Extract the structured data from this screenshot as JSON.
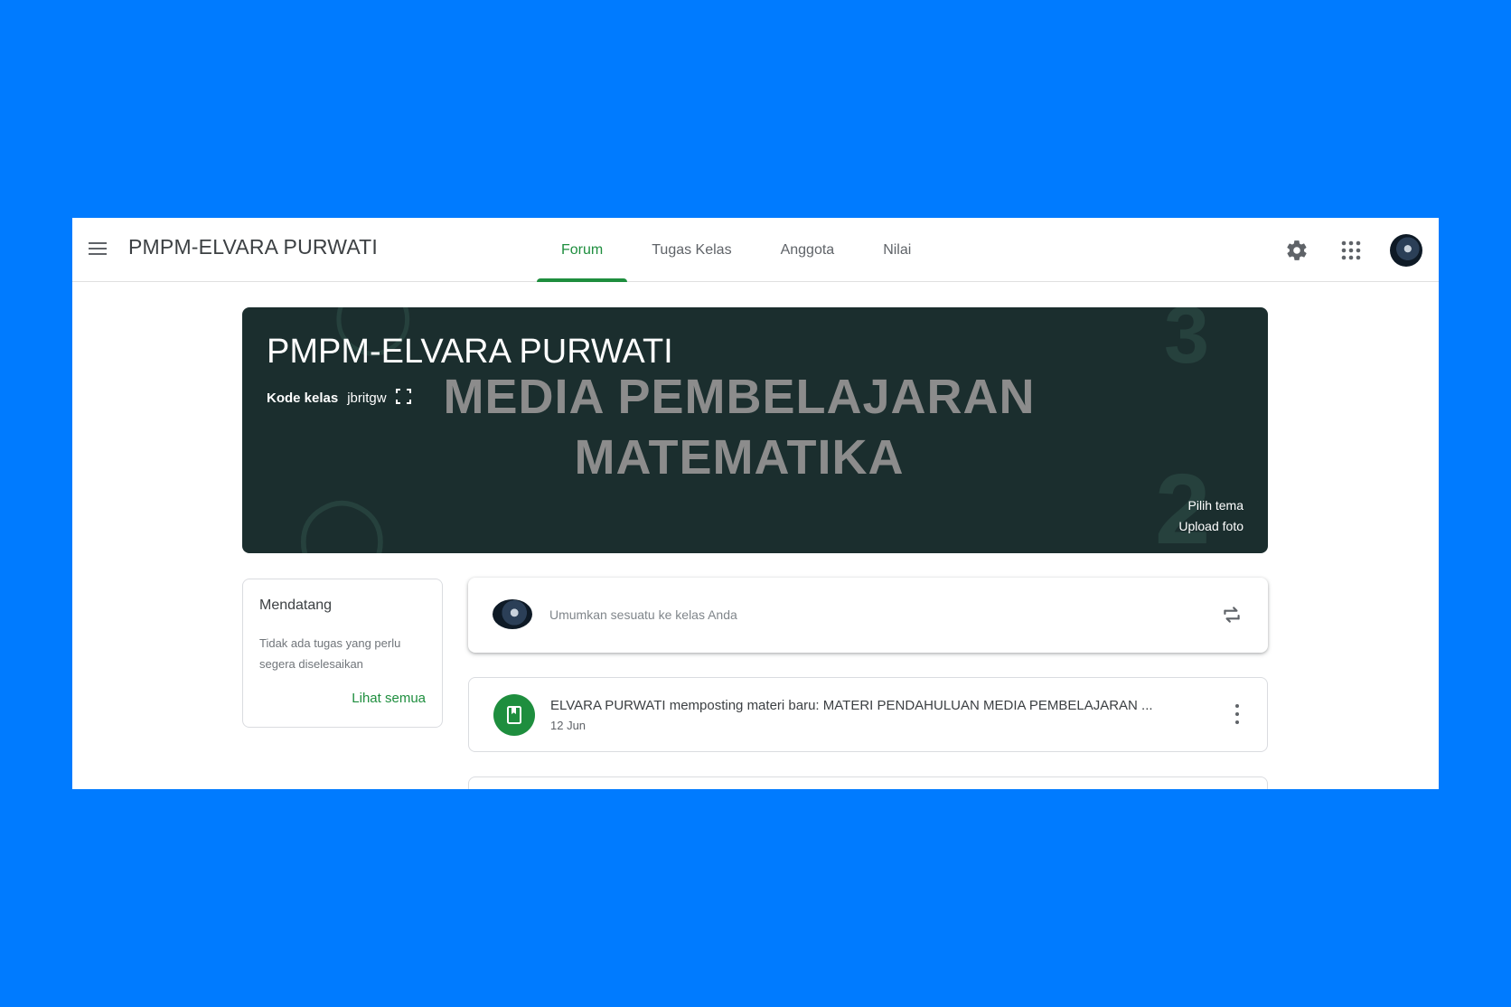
{
  "header": {
    "class_name": "PMPM-ELVARA PURWATI",
    "tabs": [
      {
        "label": "Forum",
        "active": true
      },
      {
        "label": "Tugas Kelas",
        "active": false
      },
      {
        "label": "Anggota",
        "active": false
      },
      {
        "label": "Nilai",
        "active": false
      }
    ],
    "icons": [
      "menu-icon",
      "settings-gear-icon",
      "apps-grid-icon",
      "account-avatar"
    ]
  },
  "banner": {
    "title": "PMPM-ELVARA PURWATI",
    "code_label": "Kode kelas",
    "code_value": "jbritgw",
    "image_text_line1": "MEDIA PEMBELAJARAN",
    "image_text_line2": "MATEMATIKA",
    "choose_theme": "Pilih tema",
    "upload_photo": "Upload foto"
  },
  "upcoming": {
    "heading": "Mendatang",
    "description": "Tidak ada tugas yang perlu segera diselesaikan",
    "view_all": "Lihat semua"
  },
  "announce": {
    "placeholder": "Umumkan sesuatu ke kelas Anda"
  },
  "posts": [
    {
      "title": "ELVARA PURWATI memposting materi baru: MATERI PENDAHULUAN MEDIA PEMBELAJARAN ...",
      "date": "12 Jun"
    }
  ],
  "colors": {
    "background": "#007bff",
    "accent_green": "#1e8e3e",
    "banner_bg": "#1b2e2e"
  }
}
